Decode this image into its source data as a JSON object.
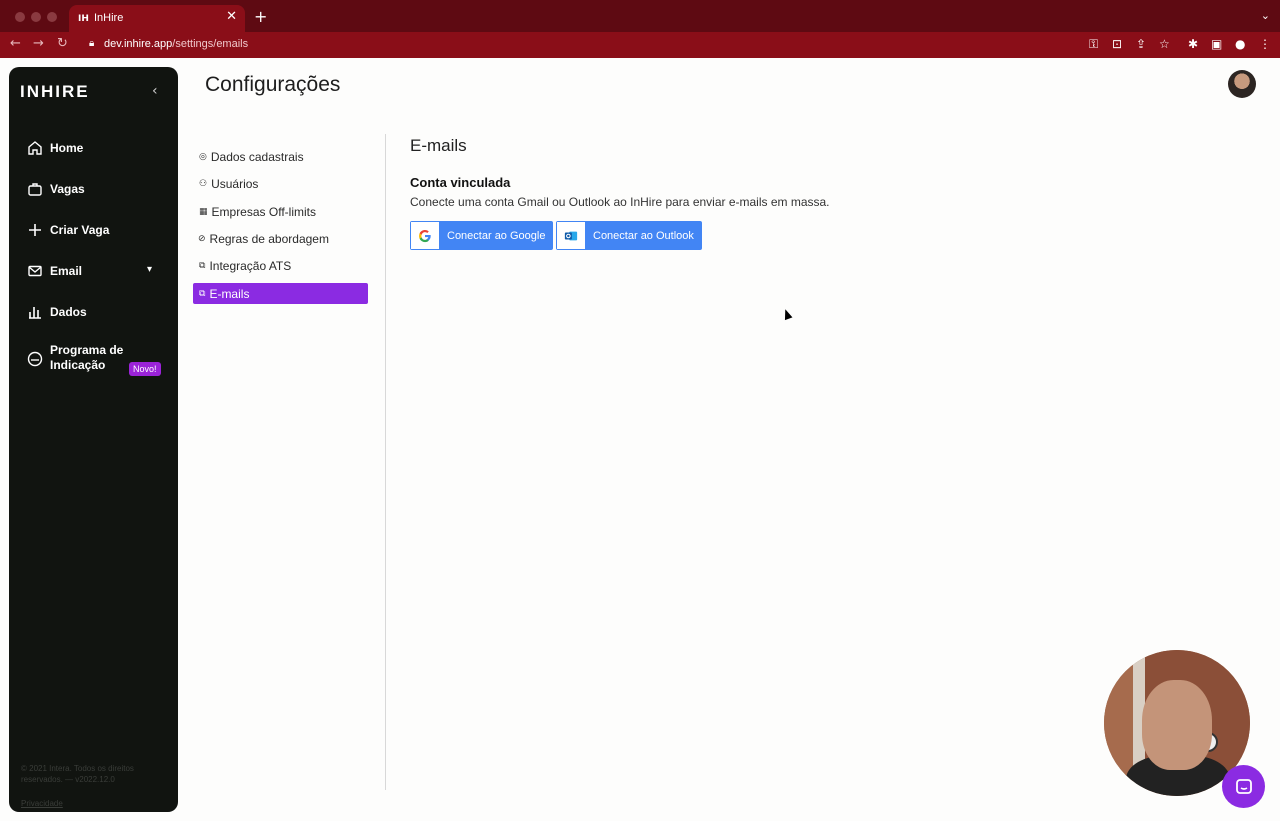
{
  "browser": {
    "tab_title": "InHire",
    "tab_favicon": "IH",
    "url_host": "dev.inhire.app",
    "url_path": "/settings/emails"
  },
  "sidebar": {
    "logo": "INHIRE",
    "items": [
      {
        "label": "Home",
        "icon": "home-icon"
      },
      {
        "label": "Vagas",
        "icon": "briefcase-icon"
      },
      {
        "label": "Criar Vaga",
        "icon": "plus-icon"
      },
      {
        "label": "Email",
        "icon": "mail-icon"
      },
      {
        "label": "Dados",
        "icon": "bar-chart-icon"
      },
      {
        "label": "Programa de\nIndicação",
        "icon": "referral-icon"
      }
    ],
    "novo_badge": "Novo!",
    "footer_note": "© 2021 Intera. Todos os direitos reservados. — v2022.12.0",
    "footer_link": "Privacidade"
  },
  "header": {
    "title": "Configurações"
  },
  "settings_menu": {
    "items": [
      {
        "label": "Dados cadastrais",
        "icon": "user-circle-icon"
      },
      {
        "label": "Usuários",
        "icon": "users-icon"
      },
      {
        "label": "Empresas Off-limits",
        "icon": "building-icon"
      },
      {
        "label": "Regras de abordagem",
        "icon": "ban-icon"
      },
      {
        "label": "Integração ATS",
        "icon": "integration-icon"
      },
      {
        "label": "E-mails",
        "icon": "email-settings-icon"
      }
    ],
    "active_index": 5
  },
  "main": {
    "section_title": "E-mails",
    "subtitle": "Conta vinculada",
    "description": "Conecte uma conta Gmail ou Outlook ao InHire para enviar e-mails em massa.",
    "google_button": "Conectar ao Google",
    "outlook_button": "Conectar ao Outlook"
  },
  "colors": {
    "browser_chrome": "#8a0e18",
    "sidebar_bg": "#111410",
    "accent_purple": "#8b2be2",
    "button_blue": "#4285f4"
  }
}
